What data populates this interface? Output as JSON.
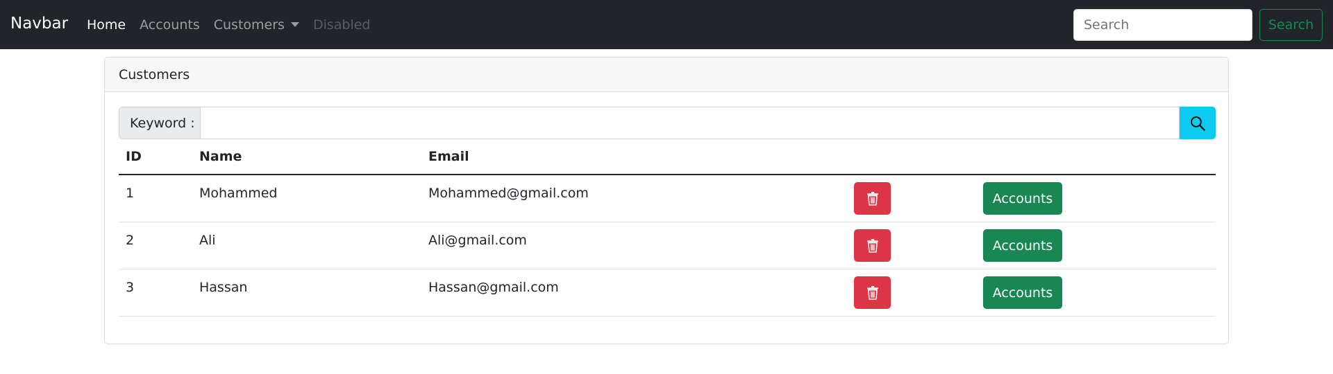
{
  "navbar": {
    "brand": "Navbar",
    "links": [
      {
        "label": "Home",
        "state": "active"
      },
      {
        "label": "Accounts",
        "state": "normal"
      },
      {
        "label": "Customers",
        "state": "dropdown"
      },
      {
        "label": "Disabled",
        "state": "disabled"
      }
    ],
    "search_placeholder": "Search",
    "search_button": "Search"
  },
  "card": {
    "header": "Customers",
    "search": {
      "label": "Keyword :",
      "value": "",
      "button_icon": "search-icon"
    },
    "table": {
      "columns": [
        "ID",
        "Name",
        "Email"
      ],
      "rows": [
        {
          "id": "1",
          "name": "Mohammed",
          "email": "Mohammed@gmail.com",
          "action_label": "Accounts"
        },
        {
          "id": "2",
          "name": "Ali",
          "email": "Ali@gmail.com",
          "action_label": "Accounts"
        },
        {
          "id": "3",
          "name": "Hassan",
          "email": "Hassan@gmail.com",
          "action_label": "Accounts"
        }
      ]
    }
  },
  "colors": {
    "navbar_bg": "#212529",
    "danger": "#dc3545",
    "success": "#198754",
    "info": "#0dcaf0"
  }
}
